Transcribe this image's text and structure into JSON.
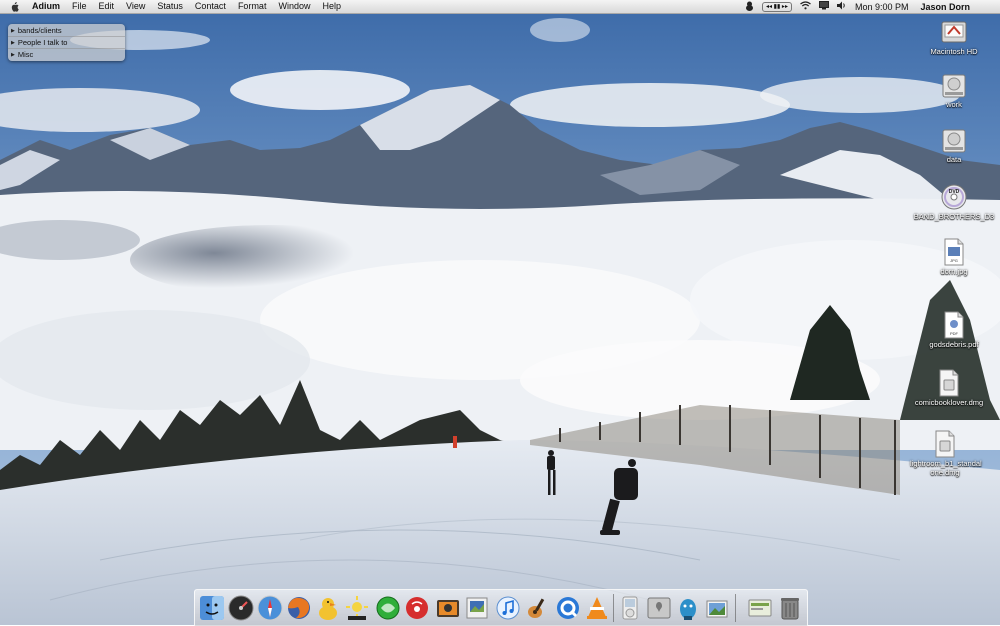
{
  "menubar": {
    "app_name": "Adium",
    "menus": [
      "File",
      "Edit",
      "View",
      "Status",
      "Contact",
      "Format",
      "Window",
      "Help"
    ],
    "clock": "Mon 9:00 PM",
    "user": "Jason Dorn"
  },
  "contact_list": {
    "groups": [
      "bands/clients",
      "People I talk to",
      "Misc"
    ]
  },
  "desktop_icons": [
    {
      "label": "Macintosh HD",
      "icon": "hard-drive-icon"
    },
    {
      "label": "work",
      "icon": "hard-drive-icon"
    },
    {
      "label": "data",
      "icon": "hard-drive-icon"
    },
    {
      "label": "BAND_BROTHERS_D3",
      "icon": "dvd-icon"
    },
    {
      "label": "dorn.jpg",
      "icon": "jpg-file-icon"
    },
    {
      "label": "godsdebris.pdf",
      "icon": "pdf-file-icon"
    },
    {
      "label": "comicbooklover.dmg",
      "icon": "disk-image-icon"
    },
    {
      "label": "lightroom_b1_standal one.dmg",
      "icon": "disk-image-icon"
    }
  ],
  "dock": {
    "items": [
      "finder-icon",
      "dashboard-icon",
      "safari-icon",
      "firefox-icon",
      "adium-icon",
      "quark-icon",
      "nvu-icon",
      "itunes-radio-icon",
      "photo-booth-icon",
      "preview-icon",
      "itunes-icon",
      "garageband-icon",
      "quicktime-icon",
      "vlc-icon",
      "ipod-icon",
      "system-preferences-icon",
      "transmit-icon",
      "photo-viewer-icon",
      "terminal-icon",
      "trash-icon"
    ]
  }
}
